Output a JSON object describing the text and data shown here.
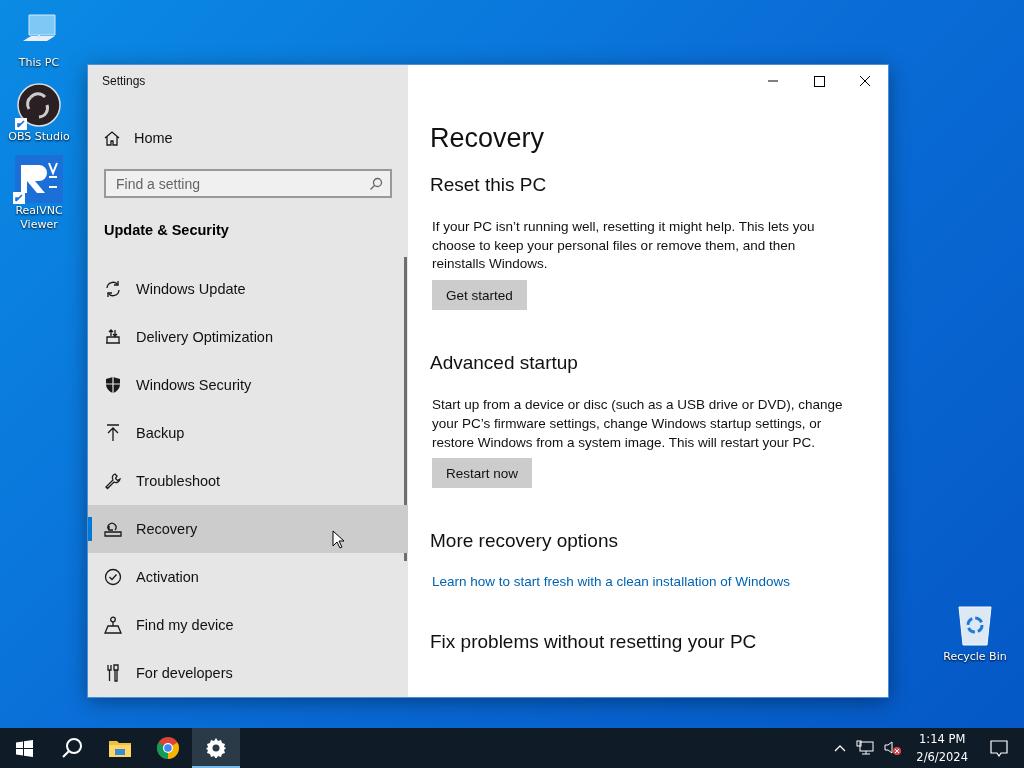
{
  "desktop_icons": [
    {
      "label": "This PC",
      "kind": "pc",
      "shortcut": false
    },
    {
      "label": "OBS Studio",
      "kind": "obs",
      "shortcut": true
    },
    {
      "label": "RealVNC Viewer",
      "kind": "vnc",
      "shortcut": true
    }
  ],
  "recycle_bin": {
    "label": "Recycle Bin"
  },
  "window": {
    "title": "Settings",
    "sidebar": {
      "home": "Home",
      "search": {
        "placeholder": "Find a setting"
      },
      "section": "Update & Security",
      "items": [
        {
          "label": "Windows Update",
          "kind": "sync",
          "selected": false
        },
        {
          "label": "Delivery Optimization",
          "kind": "delivery",
          "selected": false
        },
        {
          "label": "Windows Security",
          "kind": "shield",
          "selected": false
        },
        {
          "label": "Backup",
          "kind": "backup",
          "selected": false
        },
        {
          "label": "Troubleshoot",
          "kind": "wrench",
          "selected": false
        },
        {
          "label": "Recovery",
          "kind": "recovery",
          "selected": true
        },
        {
          "label": "Activation",
          "kind": "check",
          "selected": false
        },
        {
          "label": "Find my device",
          "kind": "person",
          "selected": false
        },
        {
          "label": "For developers",
          "kind": "tools",
          "selected": false
        }
      ]
    },
    "content": {
      "title": "Recovery",
      "sections": [
        {
          "heading": "Reset this PC",
          "body": "If your PC isn’t running well, resetting it might help. This lets you choose to keep your personal files or remove them, and then reinstalls Windows.",
          "button": "Get started"
        },
        {
          "heading": "Advanced startup",
          "body": "Start up from a device or disc (such as a USB drive or DVD), change your PC’s firmware settings, change Windows startup settings, or restore Windows from a system image. This will restart your PC.",
          "button": "Restart now"
        },
        {
          "heading": "More recovery options",
          "link": "Learn how to start fresh with a clean installation of Windows"
        },
        {
          "heading": "Fix problems without resetting your PC"
        }
      ]
    }
  },
  "taskbar": {
    "apps": [
      {
        "kind": "start",
        "active": false
      },
      {
        "kind": "search",
        "active": false
      },
      {
        "kind": "explorer",
        "active": false
      },
      {
        "kind": "chrome",
        "active": false
      },
      {
        "kind": "settings",
        "active": true
      }
    ],
    "time": "1:14 PM",
    "date": "2/6/2024"
  }
}
